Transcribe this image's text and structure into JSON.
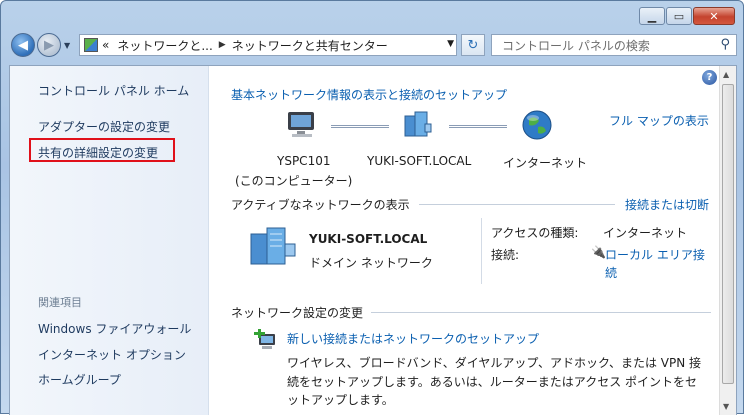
{
  "toolbar": {
    "breadcrumbs": [
      "«",
      "ネットワークと...",
      "ネットワークと共有センター"
    ],
    "search_placeholder": "コントロール パネルの検索"
  },
  "sidebar": {
    "home": "コントロール パネル ホーム",
    "adapter": "アダプターの設定の変更",
    "advanced_sharing": "共有の詳細設定の変更",
    "related_heading": "関連項目",
    "related": [
      "Windows ファイアウォール",
      "インターネット オプション",
      "ホームグループ"
    ]
  },
  "main": {
    "title": "基本ネットワーク情報の表示と接続のセットアップ",
    "full_map": "フル マップの表示",
    "map_nodes": [
      {
        "label": "YSPC101",
        "sub": "(このコンピューター)"
      },
      {
        "label": "YUKI-SOFT.LOCAL",
        "sub": ""
      },
      {
        "label": "インターネット",
        "sub": ""
      }
    ],
    "active_heading": "アクティブなネットワークの表示",
    "connect_disconnect": "接続または切断",
    "network": {
      "name": "YUKI-SOFT.LOCAL",
      "type": "ドメイン ネットワーク",
      "access_label": "アクセスの種類:",
      "access_value": "インターネット",
      "conn_label": "接続:",
      "conn_value_line1": "ローカル エリア接",
      "conn_value_line2": "続"
    },
    "change_heading": "ネットワーク設定の変更",
    "setup_link": "新しい接続またはネットワークのセットアップ",
    "setup_desc_lines": [
      "ワイヤレス、ブロードバンド、ダイヤルアップ、アドホック、または VPN 接",
      "続をセットアップします。あるいは、ルーターまたはアクセス ポイントをセ",
      "ットアップします。"
    ]
  },
  "colors": {
    "accent_link": "#0a5fb0",
    "highlight_box": "#e0101a"
  }
}
